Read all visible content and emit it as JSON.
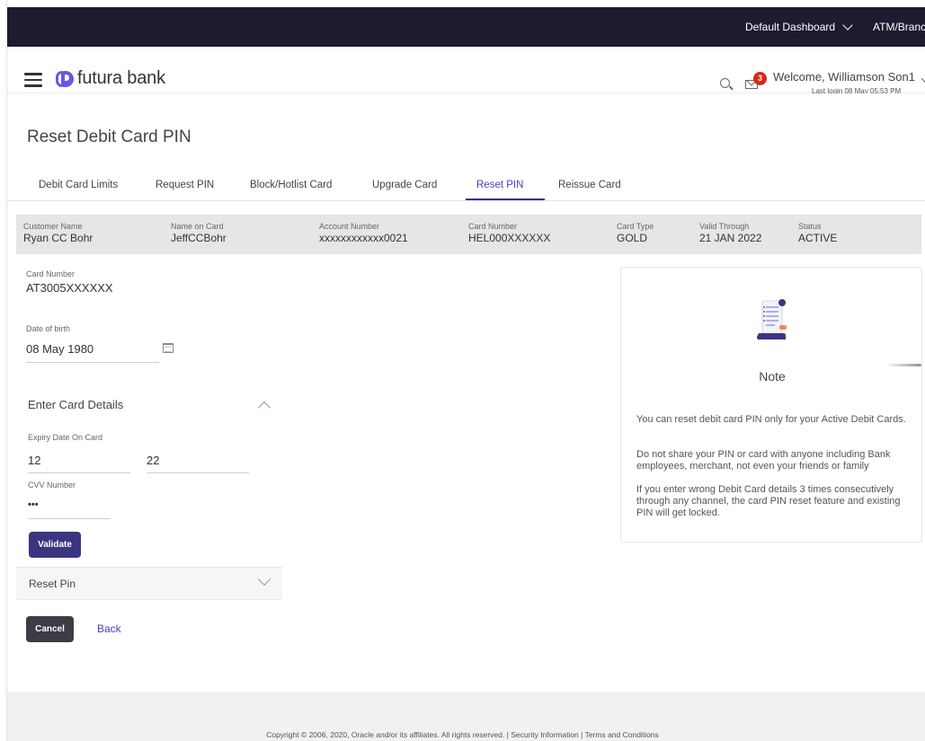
{
  "topbar": {
    "dashboard_label": "Default Dashboard",
    "branch_label": "ATM/Branch"
  },
  "header": {
    "brand": "futura bank",
    "notification_count": "3",
    "welcome": "Welcome, Williamson Son1",
    "last_login": "Last login 08 May 05:53 PM"
  },
  "page_title": "Reset Debit Card PIN",
  "tabs": [
    {
      "label": "Debit Card Limits"
    },
    {
      "label": "Request PIN"
    },
    {
      "label": "Block/Hotlist Card"
    },
    {
      "label": "Upgrade Card"
    },
    {
      "label": "Reset PIN"
    },
    {
      "label": "Reissue Card"
    }
  ],
  "card_info": {
    "customer_name": {
      "label": "Customer Name",
      "value": "Ryan CC Bohr"
    },
    "name_on_card": {
      "label": "Name on Card",
      "value": "JeffCCBohr"
    },
    "account_number": {
      "label": "Account Number",
      "value": "xxxxxxxxxxxx0021"
    },
    "card_number": {
      "label": "Card Number",
      "value": "HEL000XXXXXX"
    },
    "card_type": {
      "label": "Card Type",
      "value": "GOLD"
    },
    "valid_through": {
      "label": "Valid Through",
      "value": "21 JAN 2022"
    },
    "status": {
      "label": "Status",
      "value": "ACTIVE"
    }
  },
  "form": {
    "card_number_label": "Card Number",
    "card_number_value": "AT3005XXXXXX",
    "dob_label": "Date of birth",
    "dob_value": "08 May 1980",
    "enter_card_details": "Enter Card Details",
    "expiry_label": "Expiry Date On Card",
    "expiry_month": "12",
    "expiry_year": "22",
    "cvv_label": "CVV Number",
    "cvv_value": "•••",
    "validate_label": "Validate",
    "reset_pin_section": "Reset Pin",
    "cancel_label": "Cancel",
    "back_label": "Back"
  },
  "note": {
    "title": "Note",
    "lines": [
      "You can reset debit card PIN only for your Active Debit Cards.",
      "Do not share your PIN or card with anyone including Bank employees, merchant, not even your friends or family",
      "If you enter wrong Debit Card details 3 times consecutively through any channel, the card PIN reset feature and existing PIN will get locked."
    ]
  },
  "footer": {
    "copyright": "Copyright © 2006, 2020, Oracle and/or its affiliates. All rights reserved.",
    "security": "Security Information",
    "terms": "Terms and Conditions"
  },
  "colors": {
    "topbar": "#1d1b2f",
    "accent": "#4b3bc1",
    "button": "#3a3581",
    "badge": "#d4291b"
  }
}
